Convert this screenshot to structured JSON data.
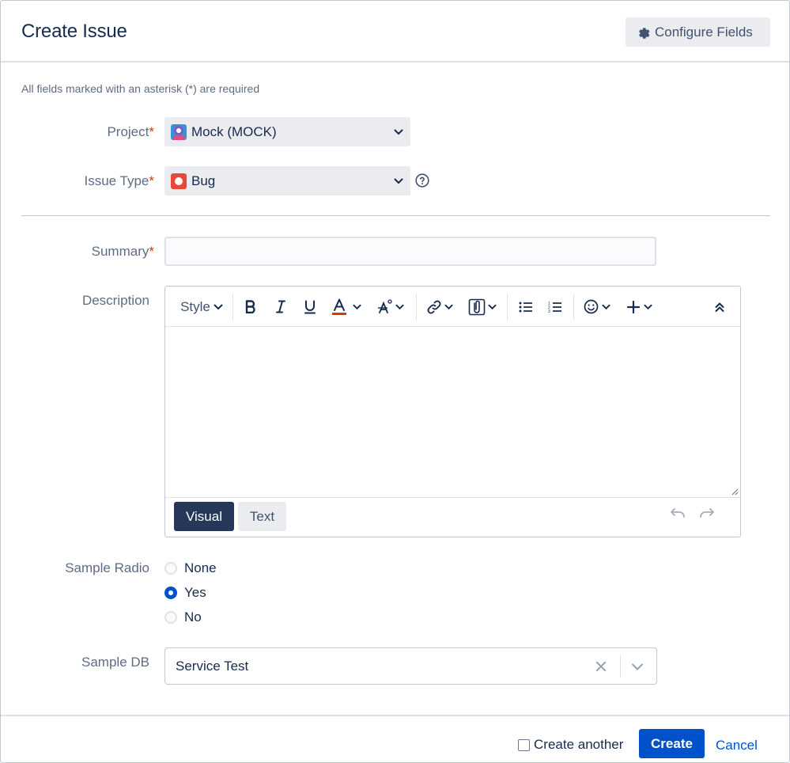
{
  "dialog": {
    "title": "Create Issue",
    "configure_fields_label": "Configure Fields",
    "required_note": "All fields marked with an asterisk (*) are required"
  },
  "fields": {
    "project": {
      "label": "Project",
      "required_mark": "*",
      "value": "Mock (MOCK)",
      "icon": "project-avatar-icon"
    },
    "issue_type": {
      "label": "Issue Type",
      "required_mark": "*",
      "value": "Bug",
      "icon": "bug-icon"
    },
    "summary": {
      "label": "Summary",
      "required_mark": "*",
      "value": ""
    },
    "description": {
      "label": "Description",
      "toolbar": {
        "style_label": "Style",
        "buttons": [
          "bold",
          "italic",
          "underline",
          "text-color",
          "text-effects",
          "link",
          "attachment",
          "bullet-list",
          "numbered-list",
          "emoji",
          "insert-more",
          "collapse-toolbar"
        ]
      },
      "modes": {
        "visual": "Visual",
        "text": "Text"
      }
    },
    "sample_radio": {
      "label": "Sample Radio",
      "options": [
        {
          "label": "None",
          "checked": false
        },
        {
          "label": "Yes",
          "checked": true
        },
        {
          "label": "No",
          "checked": false
        }
      ]
    },
    "sample_db": {
      "label": "Sample DB",
      "value": "Service Test"
    }
  },
  "footer": {
    "create_another_label": "Create another",
    "create_another_checked": false,
    "create_label": "Create",
    "cancel_label": "Cancel"
  },
  "colors": {
    "primary": "#0052cc",
    "required": "#de350b",
    "dark_button": "#253858",
    "text": "#172b4d",
    "subtle_text": "#5e6c84"
  }
}
